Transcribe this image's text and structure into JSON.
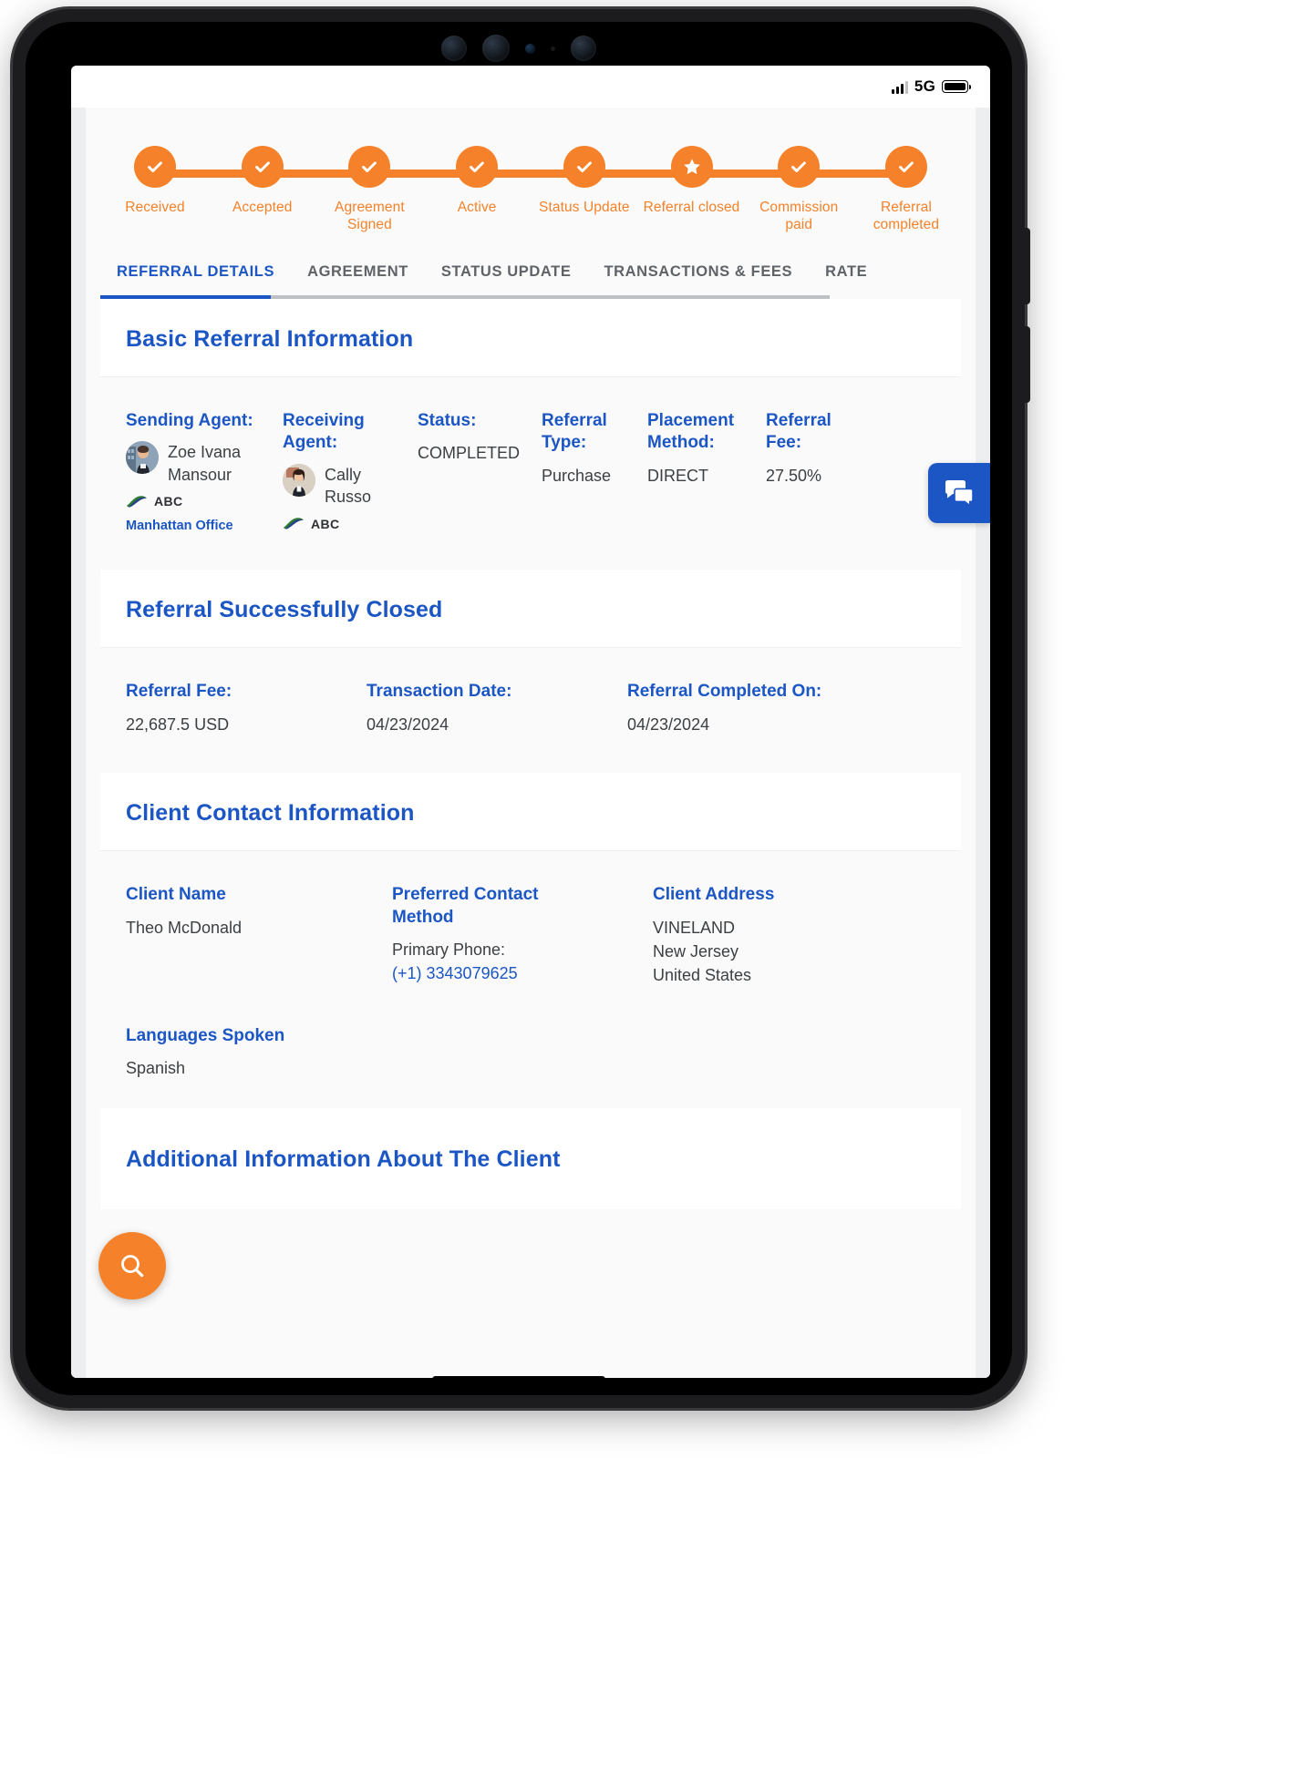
{
  "status_bar": {
    "network": "5G",
    "signal_icon": "signal-bars-icon",
    "battery_icon": "battery-icon"
  },
  "stepper": {
    "steps": [
      {
        "label": "Received",
        "icon": "check-icon",
        "state": "complete"
      },
      {
        "label": "Accepted",
        "icon": "check-icon",
        "state": "complete"
      },
      {
        "label": "Agreement Signed",
        "icon": "check-icon",
        "state": "complete"
      },
      {
        "label": "Active",
        "icon": "check-icon",
        "state": "complete"
      },
      {
        "label": "Status Update",
        "icon": "check-icon",
        "state": "complete"
      },
      {
        "label": "Referral closed",
        "icon": "star-icon",
        "state": "current"
      },
      {
        "label": "Commission paid",
        "icon": "check-icon",
        "state": "complete"
      },
      {
        "label": "Referral completed",
        "icon": "check-icon",
        "state": "complete"
      }
    ],
    "accent_color": "#f5822a"
  },
  "tabs": {
    "items": [
      {
        "label": "REFERRAL DETAILS",
        "active": true
      },
      {
        "label": "AGREEMENT",
        "active": false
      },
      {
        "label": "STATUS UPDATE",
        "active": false
      },
      {
        "label": "TRANSACTIONS & FEES",
        "active": false
      },
      {
        "label": "RATE",
        "active": false
      }
    ],
    "active_color": "#1b56c4"
  },
  "basic_referral": {
    "title": "Basic Referral Information",
    "sending_agent": {
      "label": "Sending Agent:",
      "name": "Zoe Ivana Mansour",
      "brand": "ABC",
      "office": "Manhattan Office",
      "avatar": "agent-avatar"
    },
    "receiving_agent": {
      "label": "Receiving Agent:",
      "name": "Cally Russo",
      "brand": "ABC",
      "avatar": "agent-avatar"
    },
    "status": {
      "label": "Status:",
      "value": "COMPLETED"
    },
    "referral_type": {
      "label": "Referral Type:",
      "value": "Purchase"
    },
    "placement_method": {
      "label": "Placement Method:",
      "value": "DIRECT"
    },
    "referral_fee": {
      "label": "Referral Fee:",
      "value": "27.50%"
    }
  },
  "successfully_closed": {
    "title": "Referral Successfully Closed",
    "fields": [
      {
        "label": "Referral Fee:",
        "value": "22,687.5 USD"
      },
      {
        "label": "Transaction Date:",
        "value": "04/23/2024"
      },
      {
        "label": "Referral Completed On:",
        "value": "04/23/2024"
      }
    ]
  },
  "client_contact": {
    "title": "Client Contact Information",
    "client_name": {
      "label": "Client Name",
      "value": "Theo McDonald"
    },
    "preferred_contact": {
      "label": "Preferred Contact Method",
      "sub_label": "Primary Phone:",
      "value": "(+1) 3343079625"
    },
    "client_address": {
      "label": "Client Address",
      "lines": [
        "VINELAND",
        "New Jersey",
        "United States"
      ]
    },
    "languages": {
      "label": "Languages Spoken",
      "value": "Spanish"
    }
  },
  "additional_info": {
    "title": "Additional Information About The Client"
  },
  "floating": {
    "chat_icon": "chat-bubble-icon",
    "search_icon": "search-icon",
    "chat_color": "#1b56c4",
    "search_color": "#f5822a"
  }
}
